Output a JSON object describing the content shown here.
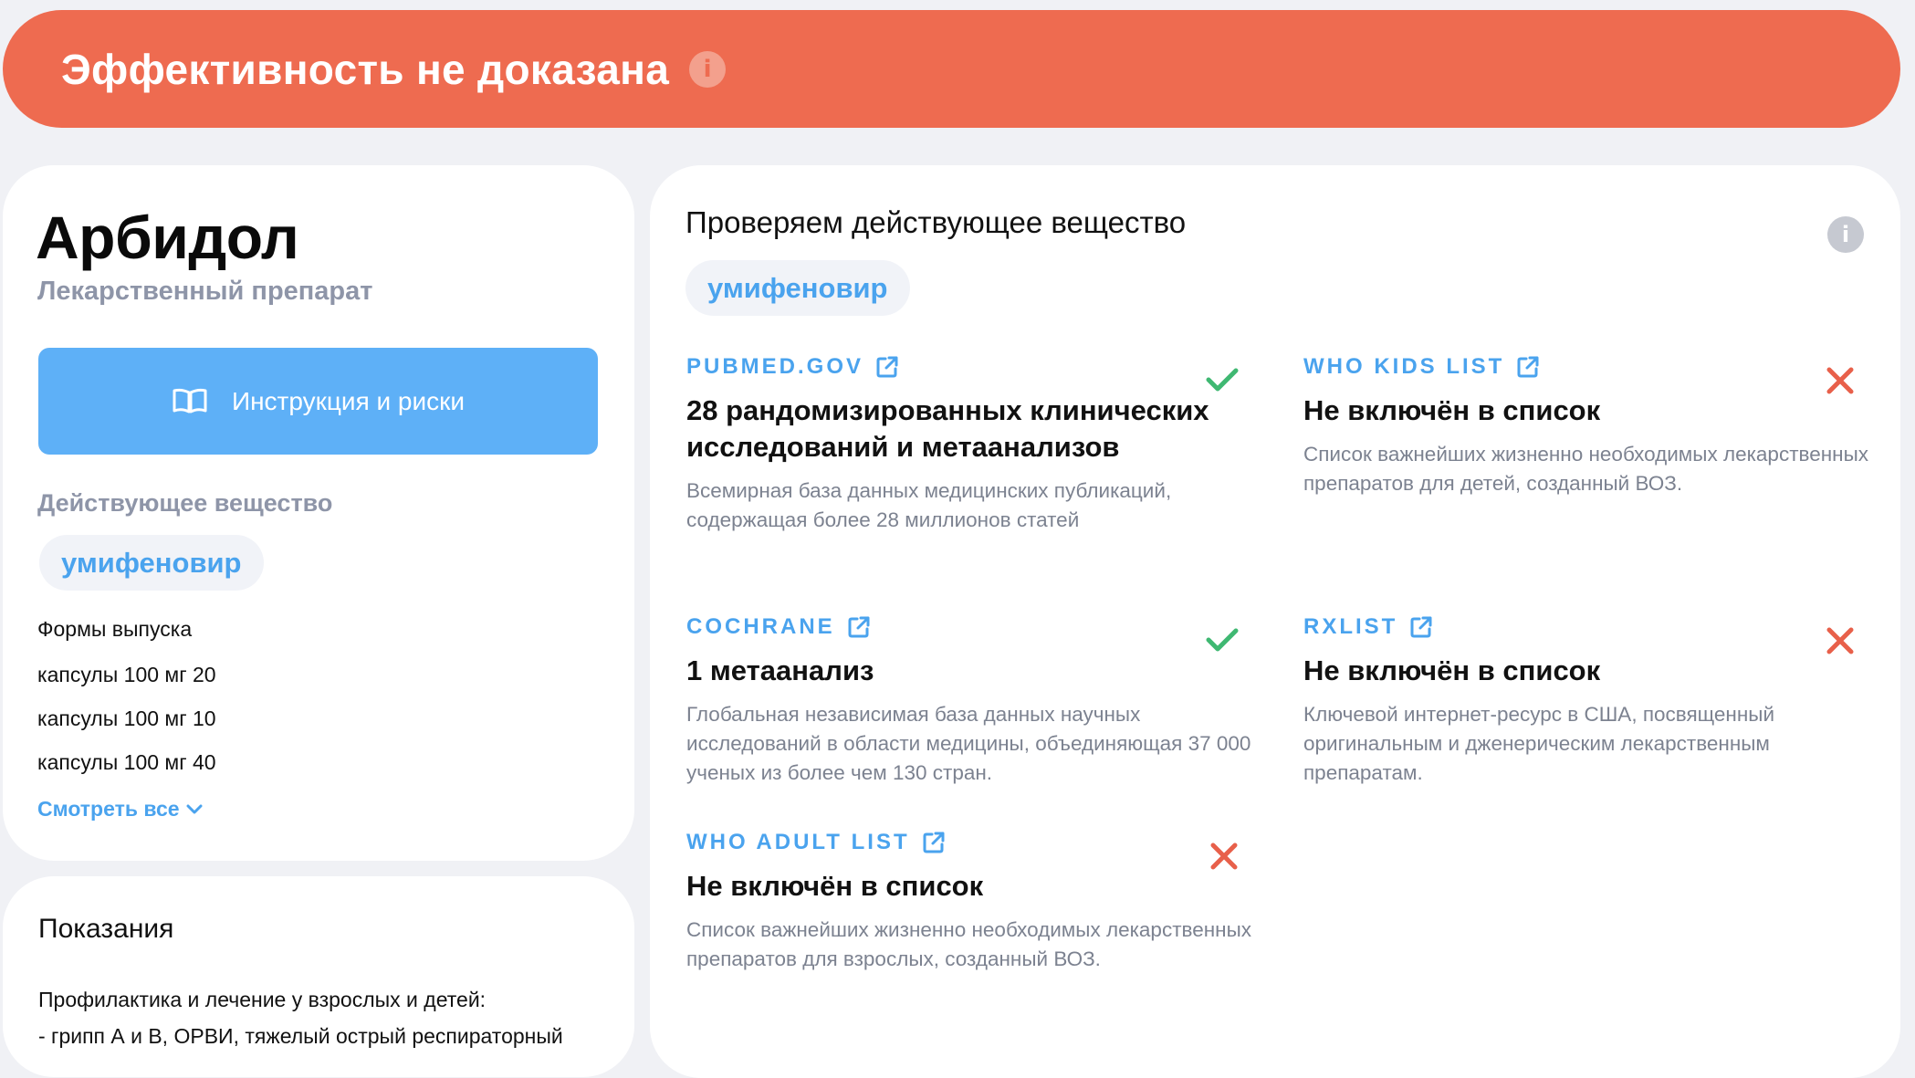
{
  "banner": {
    "title": "Эффективность не доказана",
    "info_icon": "info-icon",
    "color": "#ee6b50"
  },
  "drug": {
    "name": "Арбидол",
    "type": "Лекарственный препарат",
    "instructions_button": "Инструкция и риски",
    "instructions_icon": "book-icon",
    "substance_label": "Действующее вещество",
    "substance": "умифеновир",
    "forms_title": "Формы выпуска",
    "forms": [
      "капсулы 100 мг 20",
      "капсулы 100 мг 10",
      "капсулы 100 мг 40"
    ],
    "see_all": "Смотреть все"
  },
  "indications": {
    "title": "Показания",
    "line1": "Профилактика и лечение у взрослых и детей:",
    "line2": "- грипп А и В, ОРВИ, тяжелый острый респираторный"
  },
  "check": {
    "title": "Проверяем действующее вещество",
    "substance": "умифеновир",
    "sources": [
      {
        "name": "PUBMED.GOV",
        "status": "included",
        "headline": "28 рандомизированных клинических исследований и метаанализов",
        "description": "Всемирная база данных медицинских публикаций, содержащая более 28 миллионов статей"
      },
      {
        "name": "WHO KIDS LIST",
        "status": "not-included",
        "headline": "Не включён в список",
        "description": "Список важнейших жизненно необходимых лекарственных препаратов для детей, созданный ВОЗ."
      },
      {
        "name": "COCHRANE",
        "status": "included",
        "headline": "1 метаанализ",
        "description": "Глобальная независимая база данных научных исследований в области медицины, объединяющая 37 000 ученых из более чем 130 стран."
      },
      {
        "name": "RXLIST",
        "status": "not-included",
        "headline": "Не включён в список",
        "description": "Ключевой интернет-ресурс в США, посвященный оригинальным и дженерическим лекарственным препаратам."
      },
      {
        "name": "WHO ADULT LIST",
        "status": "not-included",
        "headline": "Не включён в список",
        "description": "Список важнейших жизненно необходимых лекарственных препаратов для взрослых, созданный ВОЗ."
      }
    ]
  },
  "colors": {
    "accent_blue": "#4aa3ee",
    "button_blue": "#5eb0f7",
    "check_green": "#3fb872",
    "cross_red": "#e8604a",
    "muted_text": "#8e95a8"
  }
}
